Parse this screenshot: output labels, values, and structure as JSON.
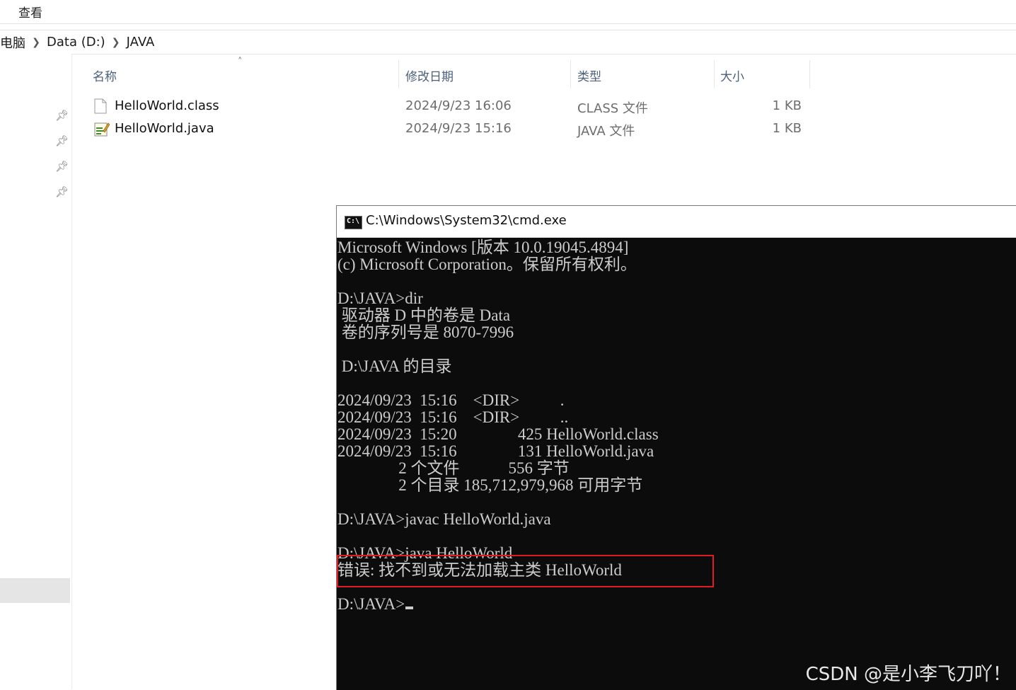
{
  "ribbon": {
    "tab_view": "查看"
  },
  "breadcrumb": [
    "电脑",
    "Data (D:)",
    "JAVA"
  ],
  "columns": {
    "name": "名称",
    "date": "修改日期",
    "type": "类型",
    "size": "大小"
  },
  "files": [
    {
      "name": "HelloWorld.class",
      "date": "2024/9/23 16:06",
      "type": "CLASS 文件",
      "size": "1 KB",
      "icon": "blank-file-icon"
    },
    {
      "name": "HelloWorld.java",
      "date": "2024/9/23 15:16",
      "type": "JAVA 文件",
      "size": "1 KB",
      "icon": "java-file-icon"
    }
  ],
  "cmd": {
    "title": "C:\\Windows\\System32\\cmd.exe",
    "icon_label": "C:\\",
    "lines": [
      "Microsoft Windows [版本 10.0.19045.4894]",
      "(c) Microsoft Corporation。保留所有权利。",
      "",
      "D:\\JAVA>dir",
      " 驱动器 D 中的卷是 Data",
      " 卷的序列号是 8070-7996",
      "",
      " D:\\JAVA 的目录",
      "",
      "2024/09/23  15:16    <DIR>          .",
      "2024/09/23  15:16    <DIR>          ..",
      "2024/09/23  15:20               425 HelloWorld.class",
      "2024/09/23  15:16               131 HelloWorld.java",
      "               2 个文件            556 字节",
      "               2 个目录 185,712,979,968 可用字节",
      "",
      "D:\\JAVA>javac HelloWorld.java",
      "",
      "D:\\JAVA>java HelloWorld",
      "错误: 找不到或无法加载主类 HelloWorld",
      "",
      "D:\\JAVA>"
    ]
  },
  "watermark": "CSDN @是小李飞刀吖！"
}
